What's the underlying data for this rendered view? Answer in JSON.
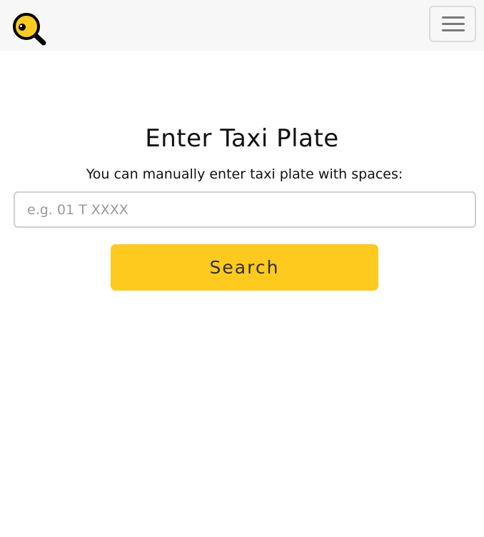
{
  "header": {
    "logo_icon": "magnifying-glass-eye-icon",
    "menu_icon": "hamburger-menu-icon",
    "brand_color": "#ffca1e"
  },
  "main": {
    "title": "Enter Taxi Plate",
    "subtitle": "You can manually enter taxi plate with spaces:",
    "plate_input": {
      "value": "",
      "placeholder": "e.g. 01 T XXXX"
    },
    "search_label": "Search"
  }
}
